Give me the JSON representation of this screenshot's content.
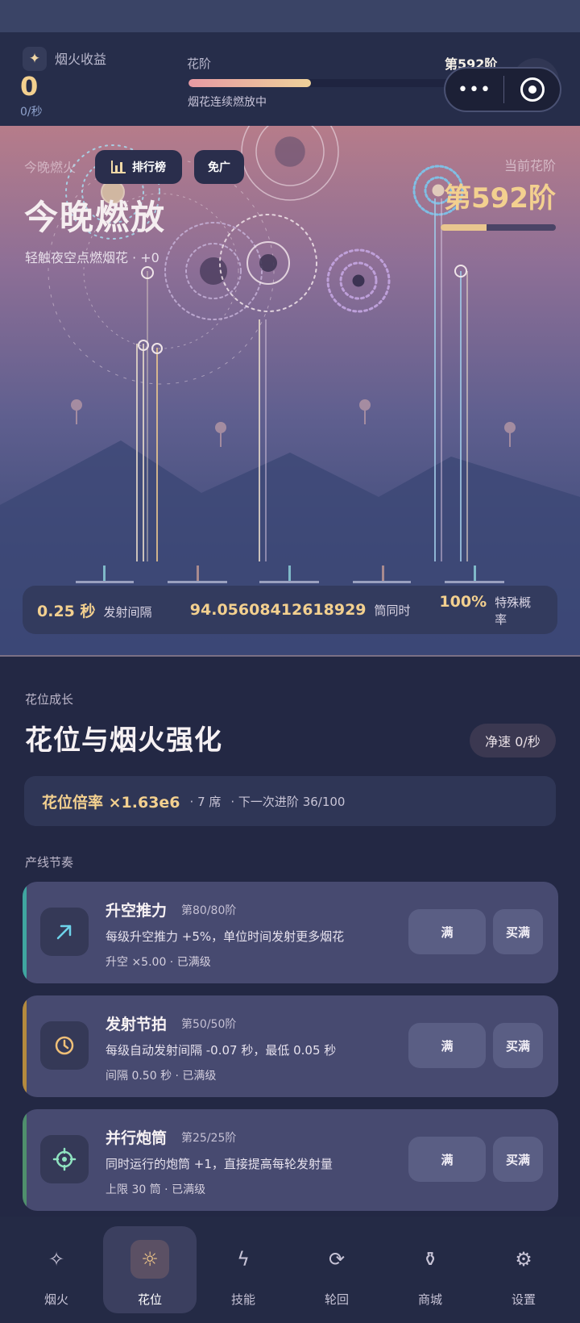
{
  "header": {
    "income_icon": "sparkle-icon",
    "income_label": "烟火收益",
    "income_value": "0",
    "income_rate": "0/秒",
    "tier_label": "花阶",
    "tier_value": "第592阶",
    "tier_progress": 0.4,
    "tier_status": "烟花连续燃放中"
  },
  "capsule": {
    "more": "•••",
    "close_icon": "target-close-icon"
  },
  "sky": {
    "faint_label": "今晚燃火",
    "rank_button": "排行榜",
    "noad_button": "免广",
    "title": "今晚燃放",
    "hint": "轻触夜空点燃烟花 · +0",
    "current_label": "当前花阶",
    "current_value": "第592阶",
    "current_progress": 0.4
  },
  "stats": {
    "interval_value": "0.25 秒",
    "interval_label": "发射间隔",
    "tubes_value": "94.05608412618929",
    "tubes_label": "筒同时",
    "special_value": "100%",
    "special_label": "特殊概率"
  },
  "section": {
    "label": "花位成长",
    "title": "花位与烟火强化",
    "speed": "净速 0/秒",
    "multiplier": "花位倍率 ×1.63e6",
    "seats": "· 7 席",
    "next": "· 下一次进阶 36/100",
    "line_label": "产线节奏"
  },
  "cards": [
    {
      "name": "升空推力",
      "level": "第80/80阶",
      "desc": "每级升空推力 +5%，单位时间发射更多烟花",
      "sub": "升空 ×5.00 · 已满级",
      "full": "满",
      "max": "买满",
      "icon": "arrow-up-right-icon",
      "accent": "#3fa6a0"
    },
    {
      "name": "发射节拍",
      "level": "第50/50阶",
      "desc": "每级自动发射间隔 -0.07 秒，最低 0.05 秒",
      "sub": "间隔 0.50 秒 · 已满级",
      "full": "满",
      "max": "买满",
      "icon": "clock-icon",
      "accent": "#b48a3e"
    },
    {
      "name": "并行炮筒",
      "level": "第25/25阶",
      "desc": "同时运行的炮筒 +1，直接提高每轮发射量",
      "sub": "上限 30 筒 · 已满级",
      "full": "满",
      "max": "买满",
      "icon": "crosshair-icon",
      "accent": "#4f8f6c"
    }
  ],
  "nav": [
    {
      "label": "烟火",
      "icon": "sparkle-icon"
    },
    {
      "label": "花位",
      "icon": "sun-icon"
    },
    {
      "label": "技能",
      "icon": "lightning-icon"
    },
    {
      "label": "轮回",
      "icon": "refresh-icon"
    },
    {
      "label": "商城",
      "icon": "shop-icon"
    },
    {
      "label": "设置",
      "icon": "gear-icon"
    }
  ],
  "colors": {
    "accent_gold": "#f3d08f",
    "background": "#232844"
  }
}
